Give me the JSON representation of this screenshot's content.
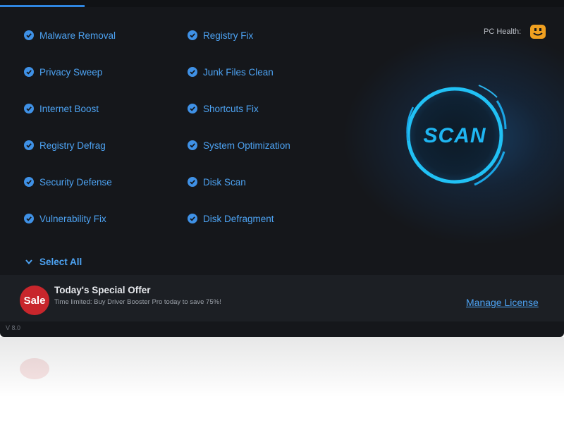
{
  "items_left": [
    {
      "label": "Malware Removal",
      "checked": true
    },
    {
      "label": "Privacy Sweep",
      "checked": true
    },
    {
      "label": "Internet Boost",
      "checked": true
    },
    {
      "label": "Registry Defrag",
      "checked": true
    },
    {
      "label": "Security Defense",
      "checked": true
    },
    {
      "label": "Vulnerability Fix",
      "checked": true
    }
  ],
  "items_right": [
    {
      "label": "Registry Fix",
      "checked": true
    },
    {
      "label": "Junk Files Clean",
      "checked": true
    },
    {
      "label": "Shortcuts Fix",
      "checked": true
    },
    {
      "label": "System Optimization",
      "checked": true
    },
    {
      "label": "Disk Scan",
      "checked": true
    },
    {
      "label": "Disk Defragment",
      "checked": true
    }
  ],
  "select_all": {
    "label": "Select All",
    "icon": "chevron-down-icon"
  },
  "health": {
    "label": "PC Health:",
    "icon": "smiley-face-icon",
    "color": "#f0a020"
  },
  "scan": {
    "label": "SCAN",
    "color": "#1fb6f2"
  },
  "offer": {
    "badge": "Sale",
    "title": "Today's Special Offer",
    "text": "Time limited: Buy Driver Booster Pro today to save 75%!"
  },
  "manage_license": "Manage License",
  "version": "V 8.0",
  "colors": {
    "background": "#15171b",
    "accent": "#4da3f3",
    "sale": "#c8262c"
  }
}
